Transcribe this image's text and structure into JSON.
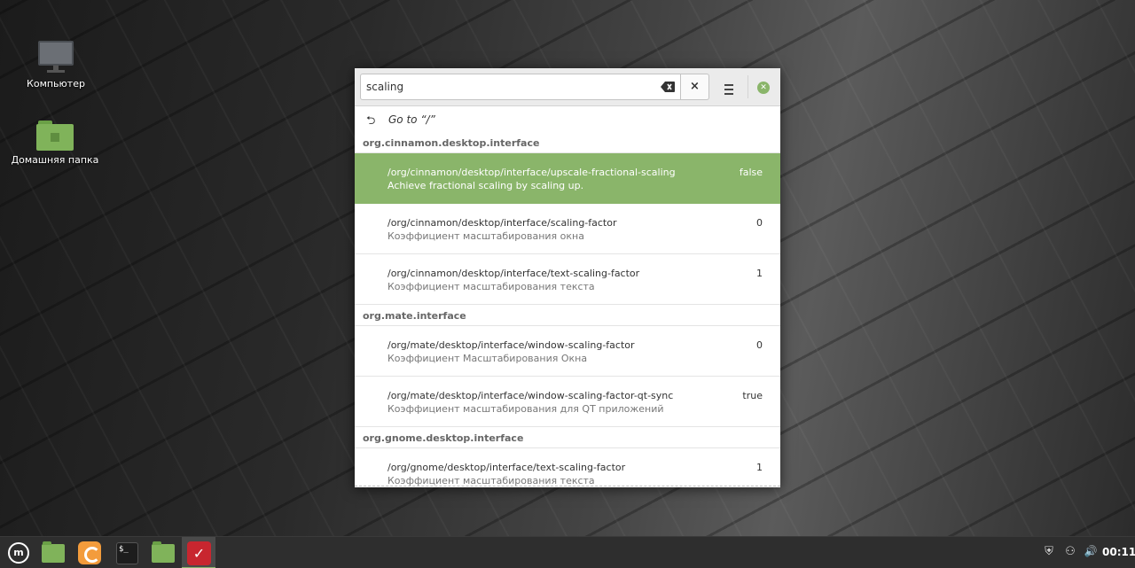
{
  "desktop": {
    "icons": [
      {
        "label": "Компьютер",
        "icon": "computer-icon"
      },
      {
        "label": "Домашняя папка",
        "icon": "home-folder-icon"
      }
    ]
  },
  "window": {
    "search": {
      "value": "scaling"
    },
    "clear_button": "×",
    "goto": "Go to “/”",
    "groups": [
      {
        "name": "org.cinnamon.desktop.interface",
        "rows": [
          {
            "key": "/org/cinnamon/desktop/interface/upscale-fractional-scaling",
            "desc": "Achieve fractional scaling by scaling up.",
            "value": "false",
            "selected": true
          },
          {
            "key": "/org/cinnamon/desktop/interface/scaling-factor",
            "desc": "Коэффициент масштабирования окна",
            "value": "0"
          },
          {
            "key": "/org/cinnamon/desktop/interface/text-scaling-factor",
            "desc": "Коэффициент масштабирования текста",
            "value": "1"
          }
        ]
      },
      {
        "name": "org.mate.interface",
        "rows": [
          {
            "key": "/org/mate/desktop/interface/window-scaling-factor",
            "desc": "Коэффициент Масштабирования Окна",
            "value": "0"
          },
          {
            "key": "/org/mate/desktop/interface/window-scaling-factor-qt-sync",
            "desc": "Коэффициент масштабирования для QT приложений",
            "value": "true"
          }
        ]
      },
      {
        "name": "org.gnome.desktop.interface",
        "rows": [
          {
            "key": "/org/gnome/desktop/interface/text-scaling-factor",
            "desc": "Коэффициент масштабирования текста",
            "value": "1"
          }
        ]
      }
    ],
    "accent": "#8ab56a"
  },
  "taskbar": {
    "mint_label": "m",
    "terminal_label": "$_",
    "dconf_label": "✓",
    "tray": {
      "shield": "⛨",
      "network": "⚇",
      "volume": "🔊"
    },
    "clock": "00:11"
  }
}
